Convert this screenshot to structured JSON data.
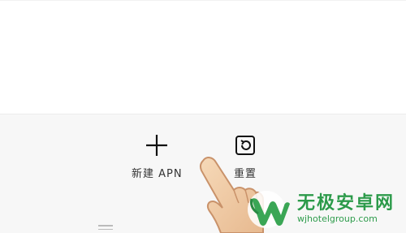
{
  "bottom_bar": {
    "new_apn": {
      "label": "新建 APN",
      "icon": "plus-icon"
    },
    "reset": {
      "label": "重置",
      "icon": "reset-icon"
    }
  },
  "nav": {
    "icon": "menu-handle-icon"
  },
  "overlay": {
    "icon": "pointing-hand-icon"
  },
  "watermark": {
    "title": "无极安卓网",
    "url": "wjhotelgroup.com",
    "color": "#2c9a4a"
  }
}
